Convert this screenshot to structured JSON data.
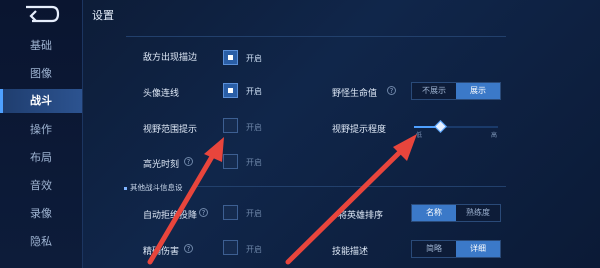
{
  "page_title": "设置",
  "sidebar": {
    "items": [
      {
        "label": "基础",
        "active": false
      },
      {
        "label": "图像",
        "active": false
      },
      {
        "label": "战斗",
        "active": true
      },
      {
        "label": "操作",
        "active": false
      },
      {
        "label": "布局",
        "active": false
      },
      {
        "label": "音效",
        "active": false
      },
      {
        "label": "录像",
        "active": false
      },
      {
        "label": "隐私",
        "active": false
      }
    ]
  },
  "sections": {
    "other_battle_info": "其他战斗信息设"
  },
  "settings": {
    "enemy_appear_outline": {
      "label": "敌方出现描边",
      "state_label": "开启",
      "checked": true
    },
    "avatar_line": {
      "label": "头像连线",
      "state_label": "开启",
      "checked": true
    },
    "vision_range_hint": {
      "label": "视野范围提示",
      "state_label": "开启",
      "checked": false
    },
    "highlight_moment": {
      "label": "高光时刻",
      "state_label": "开启",
      "checked": false
    },
    "auto_reject_surrender": {
      "label": "自动拒绝投降",
      "state_label": "开启",
      "checked": false
    },
    "precise_damage": {
      "label": "精确伤害",
      "state_label": "开启",
      "checked": false
    },
    "wild_monster_hp": {
      "label": "野怪生命值",
      "options": [
        "不展示",
        "展示"
      ],
      "selected": 1
    },
    "vision_hint_level": {
      "label": "视野提示程度",
      "low": "低",
      "high": "高",
      "value_fraction": 0.33
    },
    "hero_sort": {
      "label": "将英雄排序",
      "options": [
        "名称",
        "熟练度"
      ],
      "selected": 0
    },
    "skill_desc": {
      "label": "技能描述",
      "options": [
        "简略",
        "详细"
      ],
      "selected": 1
    }
  },
  "colors": {
    "accent": "#4ea0ff",
    "arrow": "#e8453c",
    "selected": "#3b79c8"
  }
}
